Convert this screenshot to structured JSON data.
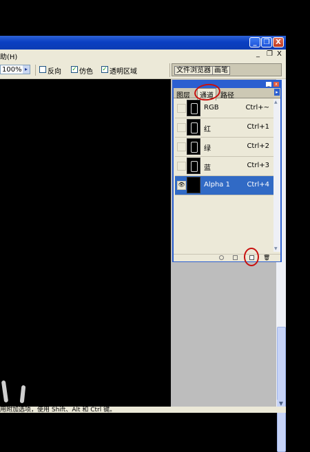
{
  "menubar": {
    "help_label": "助(H)"
  },
  "window_buttons": {
    "minimize": "_",
    "restore": "❐",
    "close": "X"
  },
  "mdi_buttons": {
    "minimize": "_",
    "restore": "❐",
    "close": "X"
  },
  "options_bar": {
    "zoom_value": "100%",
    "zoom_arrow": "▸",
    "reverse_label": "反向",
    "reverse_checked": false,
    "dither_label": "仿色",
    "dither_checked": true,
    "transparency_label": "透明区域",
    "transparency_checked": true
  },
  "palette_well": {
    "tab_file_browser": "文件浏览器",
    "tab_brushes": "画笔"
  },
  "palette": {
    "tabs": [
      {
        "label": "图层"
      },
      {
        "label": "通道"
      },
      {
        "label": "路径"
      }
    ],
    "active_tab": "通道",
    "channels": [
      {
        "name": "RGB",
        "shortcut": "Ctrl+~",
        "visible": false,
        "selected": false
      },
      {
        "name": "红",
        "shortcut": "Ctrl+1",
        "visible": false,
        "selected": false
      },
      {
        "name": "绿",
        "shortcut": "Ctrl+2",
        "visible": false,
        "selected": false
      },
      {
        "name": "蓝",
        "shortcut": "Ctrl+3",
        "visible": false,
        "selected": false
      },
      {
        "name": "Alpha 1",
        "shortcut": "Ctrl+4",
        "visible": true,
        "selected": true
      }
    ]
  },
  "status_bar": {
    "text": "用附加选项，使用 Shift、Alt 和 Ctrl 键。"
  },
  "colors": {
    "title_blue": "#0a3fc2",
    "selection_blue": "#316ac5",
    "panel": "#ece9d8",
    "annotation_red": "#c8100e"
  }
}
